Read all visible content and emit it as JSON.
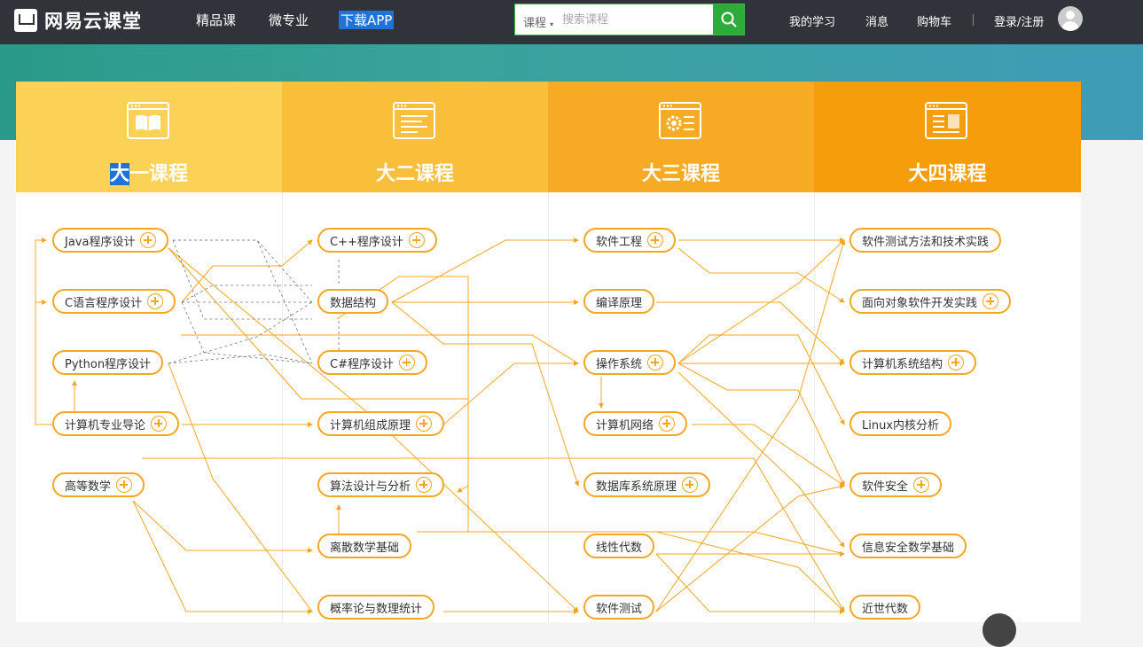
{
  "header": {
    "logo": "网易云课堂",
    "nav": [
      "精品课",
      "微专业",
      "下载APP"
    ],
    "search_type": "课程",
    "search_placeholder": "搜索课程",
    "right_nav": [
      "我的学习",
      "消息",
      "购物车",
      "登录/注册"
    ]
  },
  "columns": [
    {
      "title_hl": "大",
      "title_rest": "一课程",
      "color": "#fcd256",
      "icon": "book-window-icon"
    },
    {
      "title_hl": "",
      "title_rest": "大二课程",
      "color": "#f9bf3b",
      "icon": "document-window-icon"
    },
    {
      "title_hl": "",
      "title_rest": "大三课程",
      "color": "#f7ab24",
      "icon": "gear-window-icon"
    },
    {
      "title_hl": "",
      "title_rest": "大四课程",
      "color": "#f59d0b",
      "icon": "layout-window-icon"
    }
  ],
  "courses": {
    "java": "Java程序设计",
    "c": "C语言程序设计",
    "python": "Python程序设计",
    "intro": "计算机专业导论",
    "math": "高等数学",
    "cpp": "C++程序设计",
    "ds": "数据结构",
    "csharp": "C#程序设计",
    "org": "计算机组成原理",
    "algo": "算法设计与分析",
    "discrete": "离散数学基础",
    "prob": "概率论与数理统计",
    "se": "软件工程",
    "compiler": "编译原理",
    "os": "操作系统",
    "net": "计算机网络",
    "db": "数据库系统原理",
    "linalg": "线性代数",
    "testing": "软件测试",
    "test_practice": "软件测试方法和技术实践",
    "oo_practice": "面向对象软件开发实践",
    "arch": "计算机系统结构",
    "linux": "Linux内核分析",
    "security": "软件安全",
    "sec_math": "信息安全数学基础",
    "algebra": "近世代数"
  }
}
